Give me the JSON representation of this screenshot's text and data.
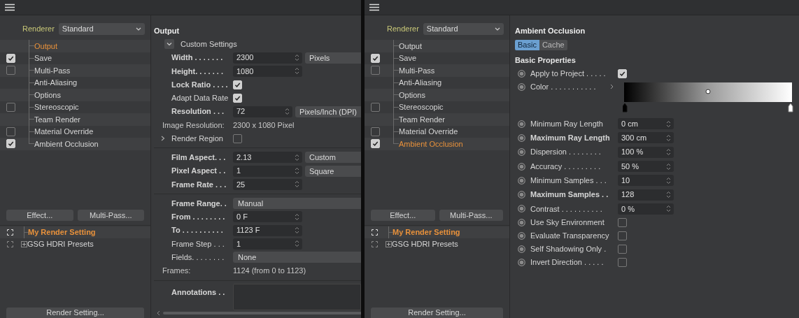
{
  "left": {
    "renderer": {
      "label": "Renderer",
      "value": "Standard"
    },
    "tree": [
      {
        "label": "Output",
        "kind": "plain",
        "selected": true
      },
      {
        "label": "Save",
        "kind": "check",
        "checked": true,
        "selected": false
      },
      {
        "label": "Multi-Pass",
        "kind": "check",
        "checked": false,
        "selected": false
      },
      {
        "label": "Anti-Aliasing",
        "kind": "plain",
        "selected": false
      },
      {
        "label": "Options",
        "kind": "plain",
        "selected": false
      },
      {
        "label": "Stereoscopic",
        "kind": "check",
        "checked": false,
        "selected": false
      },
      {
        "label": "Team Render",
        "kind": "plain",
        "selected": false
      },
      {
        "label": "Material Override",
        "kind": "check",
        "checked": false,
        "selected": false
      },
      {
        "label": "Ambient Occlusion",
        "kind": "check",
        "checked": true,
        "selected": false
      }
    ],
    "buttons": [
      "Effect...",
      "Multi-Pass..."
    ],
    "presets": [
      {
        "label": "My Render Setting",
        "selected": true,
        "expandable": false
      },
      {
        "label": "GSG HDRI Presets",
        "selected": false,
        "expandable": true
      }
    ],
    "bottom_button": "Render Setting...",
    "panel": {
      "title": "Output",
      "rows": [
        {
          "kind": "group",
          "label": "Custom Settings",
          "expanded": true
        },
        {
          "kind": "number",
          "label": "Width . . . . . . .",
          "bold": true,
          "value": "2300",
          "unit": "Pixels"
        },
        {
          "kind": "number",
          "label": "Height. . . . . . .",
          "bold": true,
          "value": "1080"
        },
        {
          "kind": "check",
          "label": "Lock Ratio . . . .",
          "bold": true,
          "checked": true
        },
        {
          "kind": "check",
          "label": "Adapt Data Rate",
          "bold": false,
          "checked": true
        },
        {
          "kind": "number",
          "label": "Resolution . . .",
          "bold": true,
          "value": "72",
          "unit": "Pixels/Inch (DPI)"
        },
        {
          "kind": "info",
          "label": "Image Resolution:",
          "value": "2300 x 1080 Pixel"
        },
        {
          "kind": "section",
          "label": "Render Region",
          "expanded": false,
          "checked": false
        },
        {
          "kind": "separator"
        },
        {
          "kind": "number",
          "label": "Film Aspect. . .",
          "bold": true,
          "value": "2.13",
          "unit": "Custom"
        },
        {
          "kind": "number",
          "label": "Pixel Aspect . .",
          "bold": true,
          "value": "1",
          "unit": "Square"
        },
        {
          "kind": "number",
          "label": "Frame Rate . . .",
          "bold": true,
          "value": "25"
        },
        {
          "kind": "separator"
        },
        {
          "kind": "select",
          "label": "Frame Range. .",
          "bold": true,
          "value": "Manual"
        },
        {
          "kind": "number",
          "label": "From . . . . . . . .",
          "bold": true,
          "value": "0 F"
        },
        {
          "kind": "number",
          "label": "To . . . . . . . . . .",
          "bold": true,
          "value": "1123 F"
        },
        {
          "kind": "number",
          "label": "Frame Step . . .",
          "bold": false,
          "value": "1"
        },
        {
          "kind": "select",
          "label": "Fields. . . . . . . .",
          "bold": false,
          "value": "None"
        },
        {
          "kind": "info",
          "label": "Frames:",
          "value": "1124 (from 0 to 1123)"
        },
        {
          "kind": "separator"
        },
        {
          "kind": "text",
          "label": "Annotations . .",
          "bold": true
        }
      ]
    }
  },
  "right": {
    "renderer": {
      "label": "Renderer",
      "value": "Standard"
    },
    "tree": [
      {
        "label": "Output",
        "kind": "plain",
        "selected": false
      },
      {
        "label": "Save",
        "kind": "check",
        "checked": true,
        "selected": false
      },
      {
        "label": "Multi-Pass",
        "kind": "check",
        "checked": false,
        "selected": false
      },
      {
        "label": "Anti-Aliasing",
        "kind": "plain",
        "selected": false
      },
      {
        "label": "Options",
        "kind": "plain",
        "selected": false
      },
      {
        "label": "Stereoscopic",
        "kind": "check",
        "checked": false,
        "selected": false
      },
      {
        "label": "Team Render",
        "kind": "plain",
        "selected": false
      },
      {
        "label": "Material Override",
        "kind": "check",
        "checked": false,
        "selected": false
      },
      {
        "label": "Ambient Occlusion",
        "kind": "check",
        "checked": true,
        "selected": true
      }
    ],
    "buttons": [
      "Effect...",
      "Multi-Pass..."
    ],
    "presets": [
      {
        "label": "My Render Setting",
        "selected": true,
        "expandable": false
      },
      {
        "label": "GSG HDRI Presets",
        "selected": false,
        "expandable": true
      }
    ],
    "bottom_button": "Render Setting...",
    "panel": {
      "title": "Ambient Occlusion",
      "tabs": [
        {
          "label": "Basic",
          "selected": true
        },
        {
          "label": "Cache",
          "selected": false
        }
      ],
      "section": "Basic Properties",
      "rows": [
        {
          "kind": "check",
          "label": "Apply to Project . . . . .",
          "bold": false,
          "checked": true
        },
        {
          "kind": "gradient",
          "label": "Color . . . . . . . . . . ."
        },
        {
          "kind": "number",
          "label": "Minimum Ray Length",
          "bold": false,
          "value": "0 cm"
        },
        {
          "kind": "number",
          "label": "Maximum Ray Length",
          "bold": true,
          "value": "300 cm"
        },
        {
          "kind": "number",
          "label": "Dispersion . . . . . . . .",
          "bold": false,
          "value": "100 %"
        },
        {
          "kind": "number",
          "label": "Accuracy . . . . . . . . .",
          "bold": false,
          "value": "50 %"
        },
        {
          "kind": "number",
          "label": "Minimum Samples . . .",
          "bold": false,
          "value": "10"
        },
        {
          "kind": "number",
          "label": "Maximum Samples . .",
          "bold": true,
          "value": "128"
        },
        {
          "kind": "number",
          "label": "Contrast . . . . . . . . . .",
          "bold": false,
          "value": "0 %"
        },
        {
          "kind": "check",
          "label": "Use Sky Environment",
          "bold": false,
          "checked": false
        },
        {
          "kind": "check",
          "label": "Evaluate Transparency",
          "bold": false,
          "checked": false
        },
        {
          "kind": "check",
          "label": "Self Shadowing Only  .",
          "bold": false,
          "checked": false
        },
        {
          "kind": "check",
          "label": "Invert Direction . . . . .",
          "bold": false,
          "checked": false
        }
      ]
    }
  }
}
